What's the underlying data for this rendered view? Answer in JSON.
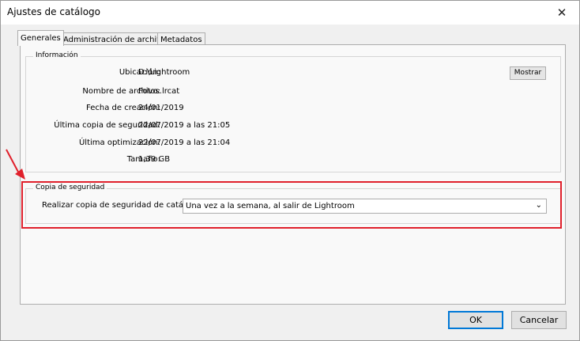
{
  "window": {
    "title": "Ajustes de catálogo"
  },
  "tabs": [
    {
      "label": "Generales",
      "active": true
    },
    {
      "label": "Administración de archivos",
      "active": false
    },
    {
      "label": "Metadatos",
      "active": false
    }
  ],
  "info": {
    "group_label": "Información",
    "rows": [
      {
        "label": "Ubicación:",
        "value": "D:\\Lightroom"
      },
      {
        "label": "Nombre de archivo:",
        "value": "Fotos.lrcat"
      },
      {
        "label": "Fecha de creación:",
        "value": "24/01/2019"
      },
      {
        "label": "Última copia de seguridad:",
        "value": "22/07/2019 a las 21:05"
      },
      {
        "label": "Última optimización:",
        "value": "22/07/2019 a las 21:04"
      },
      {
        "label": "Tamaño:",
        "value": "1,39 GB"
      }
    ],
    "show_button": "Mostrar"
  },
  "backup": {
    "group_label": "Copia de seguridad",
    "label": "Realizar copia de seguridad de catálogo:",
    "selected": "Una vez a la semana, al salir de Lightroom"
  },
  "buttons": {
    "ok": "OK",
    "cancel": "Cancelar"
  },
  "colors": {
    "highlight": "#e0202b",
    "focus": "#0078d7"
  },
  "icons": {
    "close": "close-icon",
    "dropdown": "chevron-down-icon",
    "annotation": "arrow-icon"
  }
}
